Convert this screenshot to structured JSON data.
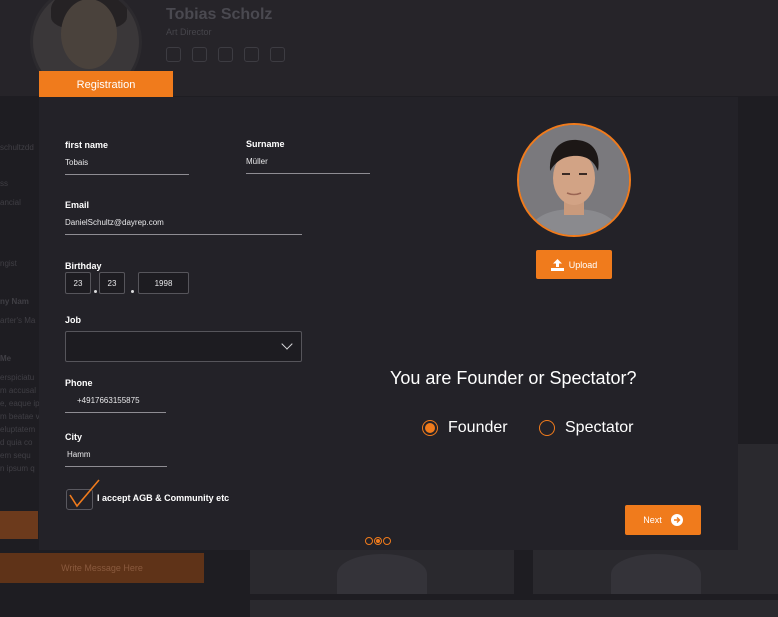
{
  "background": {
    "profile_name": "Tobias Scholz",
    "profile_role": "Art Director",
    "socials": [
      "facebook-icon",
      "twitter-icon",
      "youtube-icon",
      "linkedin-icon",
      "instagram-icon"
    ],
    "side_fragments": [
      "schultzdd",
      "ss",
      "ancial",
      "ngist",
      "ny Nam",
      "arter's Ma",
      "Me",
      "erspiciatu",
      "m accusal",
      "e, eaque ip",
      "m beatae v",
      "eluptatem",
      "d quia co",
      "em sequ",
      "n ipsum q"
    ],
    "write_message_button": "Write Message Here"
  },
  "registration": {
    "tab_label": "Registration",
    "first_name": {
      "label": "first name",
      "value": "Tobais"
    },
    "surname": {
      "label": "Surname",
      "value": "Müller"
    },
    "email": {
      "label": "Email",
      "value": "DanielSchultz@dayrep.com"
    },
    "birthday": {
      "label": "Birthday",
      "day": "23",
      "month": "23",
      "year": "1998"
    },
    "job": {
      "label": "Job",
      "value": ""
    },
    "phone": {
      "label": "Phone",
      "value": "+4917663155875"
    },
    "city": {
      "label": "City",
      "value": "Hamm"
    },
    "accept": {
      "label": "I accept AGB & Community etc",
      "checked": true
    },
    "upload_label": "Upload",
    "question": "You are Founder or Spectator?",
    "options": [
      {
        "label": "Founder",
        "selected": true
      },
      {
        "label": "Spectator",
        "selected": false
      }
    ],
    "next_label": "Next",
    "steps": {
      "total": 3,
      "current": 2
    }
  },
  "colors": {
    "accent": "#f07b1c",
    "panel": "#232228",
    "background": "#1e1d22"
  }
}
